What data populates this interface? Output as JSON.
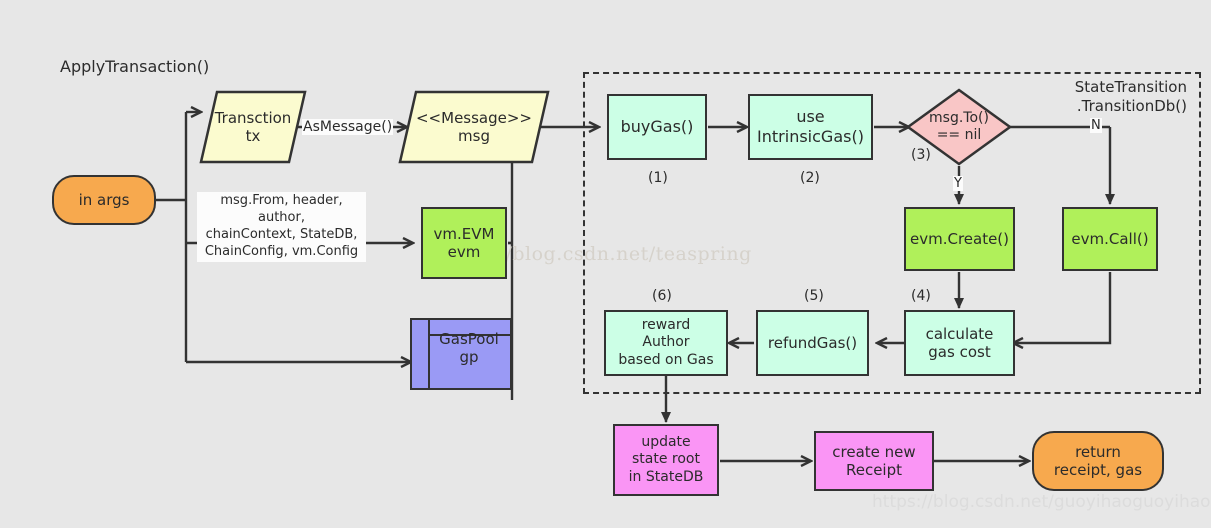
{
  "diagram": {
    "title": "ApplyTransaction()",
    "region_title": "StateTransition\n.TransitionDb()",
    "watermark_top": "http://blog.csdn.net/teaspring",
    "watermark_bottom": "https://blog.csdn.net/guoyihaoguoyihao",
    "colors": {
      "background": "#e7e7e7",
      "mint": "#ccffe6",
      "green": "#b0f05a",
      "pink": "#fa95f5",
      "orange": "#f7a94e",
      "cream": "#fbfbcf",
      "blue": "#9a9af5",
      "diamond": "#f9c6c6",
      "stroke": "#333333"
    }
  },
  "nodes": {
    "in_args": "in args",
    "transaction_tx": "Transction\ntx",
    "message_msg": "<<Message>>\nmsg",
    "vm_evm": "vm.EVM\nevm",
    "gas_pool": "GasPool\ngp",
    "buy_gas": "buyGas()",
    "use_intrinsic_gas": "use\nIntrinsicGas()",
    "decision_msg_to": "msg.To()\n== nil",
    "evm_create": "evm.Create()",
    "evm_call": "evm.Call()",
    "calculate_gas_cost": "calculate\ngas cost",
    "refund_gas": "refundGas()",
    "reward_author": "reward\nAuthor\nbased on Gas",
    "update_state_root": "update\nstate root\nin StateDB",
    "create_new_receipt": "create new\nReceipt",
    "return_receipt_gas": "return\nreceipt, gas"
  },
  "node_lines": {
    "transaction_tx": [
      "Transction",
      "tx"
    ],
    "message_msg": [
      "<<Message>>",
      "msg"
    ],
    "vm_evm": [
      "vm.EVM",
      "evm"
    ],
    "gas_pool": [
      "GasPool",
      "gp"
    ],
    "use_intrinsic_gas": [
      "use",
      "IntrinsicGas()"
    ],
    "decision_msg_to": [
      "msg.To()",
      "== nil"
    ],
    "calculate_gas_cost": [
      "calculate",
      "gas cost"
    ],
    "reward_author": [
      "reward",
      "Author",
      "based on Gas"
    ],
    "update_state_root": [
      "update",
      "state root",
      "in StateDB"
    ],
    "create_new_receipt": [
      "create new",
      "Receipt"
    ],
    "return_receipt_gas": [
      "return",
      "receipt, gas"
    ]
  },
  "edge_labels": {
    "as_message": "AsMessage()",
    "args_list": [
      "msg.From, header, author,",
      "chainContext, StateDB,",
      "ChainConfig, vm.Config"
    ],
    "yes": "Y",
    "no": "N"
  },
  "step_numbers": {
    "one": "(1)",
    "two": "(2)",
    "three": "(3)",
    "four": "(4)",
    "five": "(5)",
    "six": "(6)"
  }
}
